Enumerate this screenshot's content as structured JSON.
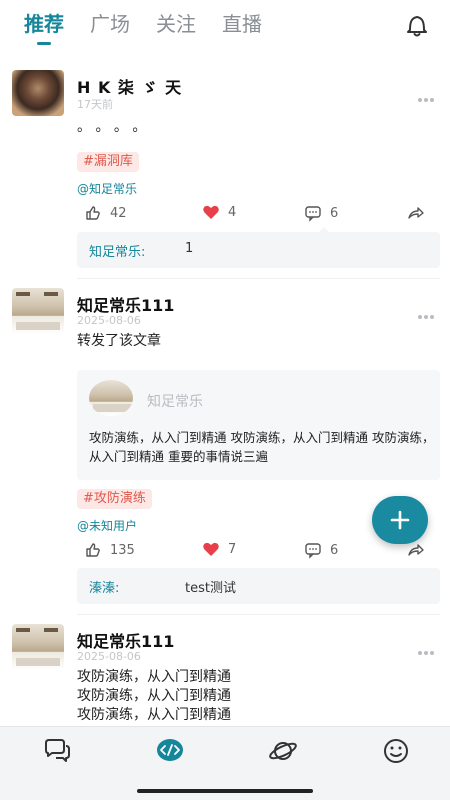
{
  "tabs": [
    {
      "label": "推荐",
      "active": true
    },
    {
      "label": "广场",
      "active": false
    },
    {
      "label": "关注",
      "active": false
    },
    {
      "label": "直播",
      "active": false
    }
  ],
  "icons": {
    "bell": "bell-icon",
    "more": "more-icon",
    "like": "thumb-icon",
    "heart": "heart-icon",
    "comment": "comment-icon",
    "share": "share-icon",
    "add": "plus-icon",
    "nav": [
      "chat-icon",
      "code-icon",
      "planet-icon",
      "smile-icon"
    ]
  },
  "colors": {
    "accent": "#16869b",
    "tag_bg": "#fde8e6",
    "tag_text": "#e05a4e",
    "heart": "#e8404a"
  },
  "posts": [
    {
      "author": "H K 柒 ゞ 天",
      "time": "17天前",
      "body": "。 。 。 。",
      "tag": "#漏洞库",
      "mention": "@知足常乐",
      "likes": "42",
      "hearts": "4",
      "comments": "6",
      "comment": {
        "name": "知足常乐:",
        "text": "1"
      }
    },
    {
      "author": "知足常乐111",
      "time": "2025-08-06",
      "body": "转发了该文章",
      "quote": {
        "name": "知足常乐",
        "text": "攻防演练，从入门到精通 攻防演练，从入门到精通 攻防演练，从入门到精通 重要的事情说三遍"
      },
      "tag": "#攻防演练",
      "mention": "@未知用户",
      "likes": "135",
      "hearts": "7",
      "comments": "6",
      "comment": {
        "name": "溱溱:",
        "text": "test测试"
      }
    },
    {
      "author": "知足常乐111",
      "time": "2025-08-06",
      "lines": [
        "攻防演练，从入门到精通",
        "攻防演练，从入门到精通",
        "攻防演练，从入门到精通"
      ]
    }
  ]
}
